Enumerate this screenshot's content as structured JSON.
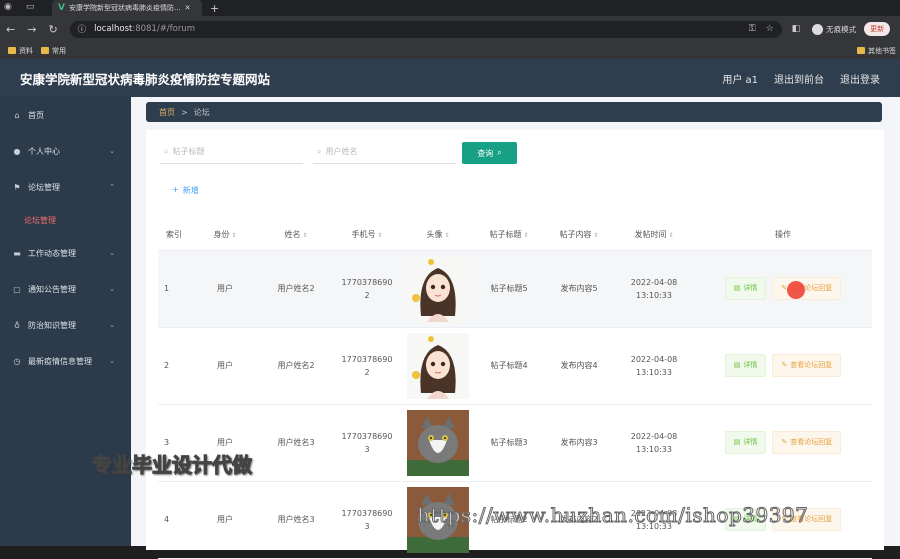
{
  "browser": {
    "tab_title": "安康学院新型冠状病毒肺炎疫情防...",
    "url_host": "localhost",
    "url_path": ":8081/#/forum",
    "incognito_label": "无痕模式",
    "update_label": "更新",
    "bookmarks": [
      "资料",
      "常用"
    ],
    "other_bookmarks": "其他书签"
  },
  "header": {
    "title": "安康学院新型冠状病毒肺炎疫情防控专题网站",
    "user": "用户 a1",
    "back_front": "退出到前台",
    "logout": "退出登录"
  },
  "sidebar": {
    "items": [
      {
        "label": "首页",
        "icon": "home-icon"
      },
      {
        "label": "个人中心",
        "icon": "user-icon"
      },
      {
        "label": "论坛管理",
        "icon": "flag-icon"
      },
      {
        "label": "工作动态管理",
        "icon": "card-icon"
      },
      {
        "label": "通知公告管理",
        "icon": "message-icon"
      },
      {
        "label": "防治知识管理",
        "icon": "mic-icon"
      },
      {
        "label": "最新疫情信息管理",
        "icon": "clock-icon"
      }
    ],
    "sub_active": "论坛管理"
  },
  "breadcrumb": {
    "home": "首页",
    "sep": ">",
    "current": "论坛"
  },
  "search": {
    "title_placeholder": "帖子标题",
    "name_placeholder": "用户姓名",
    "query_label": "查询",
    "add_label": "新增"
  },
  "table": {
    "headers": [
      "索引",
      "身份",
      "姓名",
      "手机号",
      "头像",
      "帖子标题",
      "帖子内容",
      "发帖时间",
      "操作"
    ],
    "rows": [
      {
        "index": "1",
        "role": "用户",
        "name": "用户姓名2",
        "phone1": "1770378690",
        "phone2": "2",
        "title": "帖子标题5",
        "content": "发布内容5",
        "date": "2022-04-08",
        "time": "13:10:33",
        "avatar": "girl"
      },
      {
        "index": "2",
        "role": "用户",
        "name": "用户姓名2",
        "phone1": "1770378690",
        "phone2": "2",
        "title": "帖子标题4",
        "content": "发布内容4",
        "date": "2022-04-08",
        "time": "13:10:33",
        "avatar": "girl"
      },
      {
        "index": "3",
        "role": "用户",
        "name": "用户姓名3",
        "phone1": "1770378690",
        "phone2": "3",
        "title": "帖子标题3",
        "content": "发布内容3",
        "date": "2022-04-08",
        "time": "13:10:33",
        "avatar": "cat"
      },
      {
        "index": "4",
        "role": "用户",
        "name": "用户姓名3",
        "phone1": "1770378690",
        "phone2": "3",
        "title": "帖子标题2",
        "content": "发布内容2",
        "date": "2022-04-08",
        "time": "13:10:33",
        "avatar": "cat"
      }
    ],
    "detail_label": "详情",
    "reply_label": "查看论坛回复"
  },
  "watermarks": {
    "text1": "专业毕业设计代做",
    "text2": "https://www.huzhan.com/ishop39397"
  }
}
